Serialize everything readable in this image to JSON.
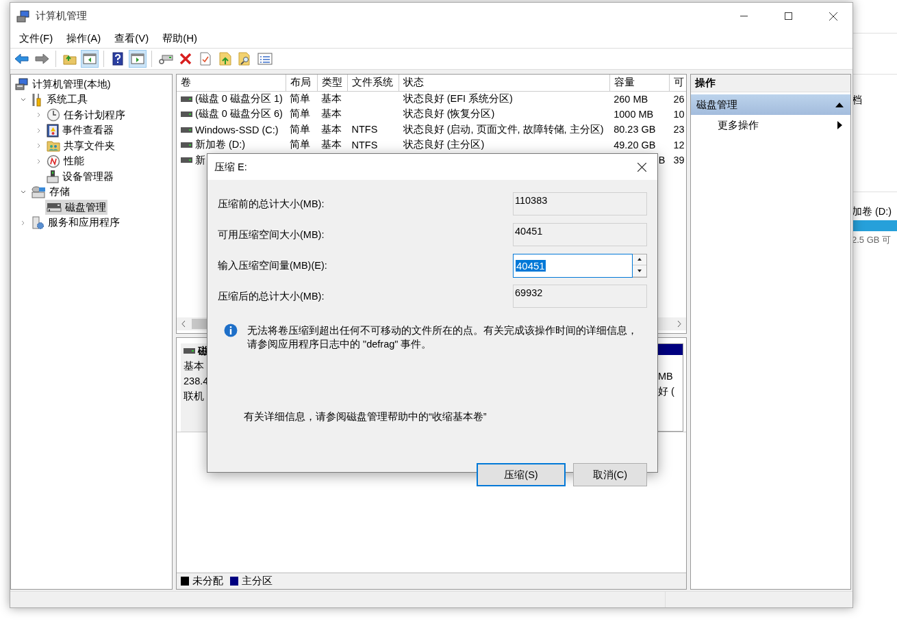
{
  "background_window": {
    "heading_fragment": "档",
    "volume_label": "加卷 (D:)",
    "free_space": "2.5 GB 可"
  },
  "window": {
    "title": "计算机管理"
  },
  "menu": [
    "文件(F)",
    "操作(A)",
    "查看(V)",
    "帮助(H)"
  ],
  "toolbar": [
    {
      "pressed": false
    },
    {
      "pressed": false
    },
    {
      "pressed": false
    },
    {
      "pressed": true
    },
    {
      "pressed": false
    },
    {
      "pressed": true
    },
    {
      "pressed": false
    },
    {
      "pressed": false
    },
    {
      "pressed": false
    },
    {
      "pressed": false
    },
    {
      "pressed": false
    },
    {
      "pressed": false
    }
  ],
  "tree": [
    {
      "label": "计算机管理(本地)",
      "selected": false,
      "children": [
        {
          "label": "系统工具",
          "expanded": true,
          "selected": false,
          "children": [
            {
              "label": "任务计划程序",
              "expanded": false,
              "selected": false
            },
            {
              "label": "事件查看器",
              "expanded": false,
              "selected": false
            },
            {
              "label": "共享文件夹",
              "expanded": false,
              "selected": false
            },
            {
              "label": "性能",
              "expanded": false,
              "selected": false
            },
            {
              "label": "设备管理器",
              "selected": false
            }
          ]
        },
        {
          "label": "存储",
          "expanded": true,
          "selected": false,
          "children": [
            {
              "label": "磁盘管理",
              "selected": true
            }
          ]
        },
        {
          "label": "服务和应用程序",
          "expanded": false,
          "selected": false
        }
      ]
    }
  ],
  "table": {
    "columns": [
      "卷",
      "布局",
      "类型",
      "文件系统",
      "状态",
      "容量",
      "可"
    ],
    "rows": [
      {
        "volume": "(磁盘 0 磁盘分区 1)",
        "layout": "简单",
        "type": "基本",
        "status": "状态良好 (EFI 系统分区)",
        "capacity": "260 MB",
        "free": "26"
      },
      {
        "volume": "(磁盘 0 磁盘分区 6)",
        "layout": "简单",
        "type": "基本",
        "status": "状态良好 (恢复分区)",
        "capacity": "1000 MB",
        "free": "10"
      },
      {
        "volume": "Windows-SSD (C:)",
        "layout": "简单",
        "type": "基本",
        "file_system": "NTFS",
        "status": "状态良好 (启动, 页面文件, 故障转储, 主分区)",
        "capacity": "80.23 GB",
        "free": "23"
      },
      {
        "volume": "新加卷 (D:)",
        "layout": "简单",
        "type": "基本",
        "file_system": "NTFS",
        "status": "状态良好 (主分区)",
        "capacity": "49.20 GB",
        "free": "12"
      },
      {
        "kind": "covered",
        "volume": "新",
        "capacity": "B",
        "free": "39"
      }
    ]
  },
  "disk_panel": {
    "name": "磁",
    "type": "基本",
    "size": "238.4",
    "status": "联机",
    "partition_size": "MB",
    "partition_status": "好 ("
  },
  "legend": [
    {
      "label": "未分配",
      "color": "#000000"
    },
    {
      "label": "主分区",
      "color": "#000080"
    }
  ],
  "actions": {
    "header": "操作",
    "sections": [
      {
        "label": "磁盘管理",
        "expanded": true,
        "items": [
          {
            "label": "更多操作"
          }
        ]
      }
    ]
  },
  "dialog": {
    "title": "压缩 E:",
    "fields": [
      {
        "kind": "readonly",
        "label": "压缩前的总计大小(MB):",
        "value": "110383"
      },
      {
        "kind": "readonly",
        "label": "可用压缩空间大小(MB):",
        "value": "40451"
      },
      {
        "kind": "spin",
        "label": "输入压缩空间量(MB)(E):",
        "value": "40451"
      },
      {
        "kind": "readonly",
        "label": "压缩后的总计大小(MB):",
        "value": "69932"
      }
    ],
    "info": "无法将卷压缩到超出任何不可移动的文件所在的点。有关完成该操作时间的详细信息，请参阅应用程序日志中的 \"defrag\" 事件。",
    "help": "有关详细信息，请参阅磁盘管理帮助中的“收缩基本卷”",
    "buttons": [
      {
        "label": "压缩(S)",
        "default": true
      },
      {
        "label": "取消(C)",
        "default": false
      }
    ]
  }
}
